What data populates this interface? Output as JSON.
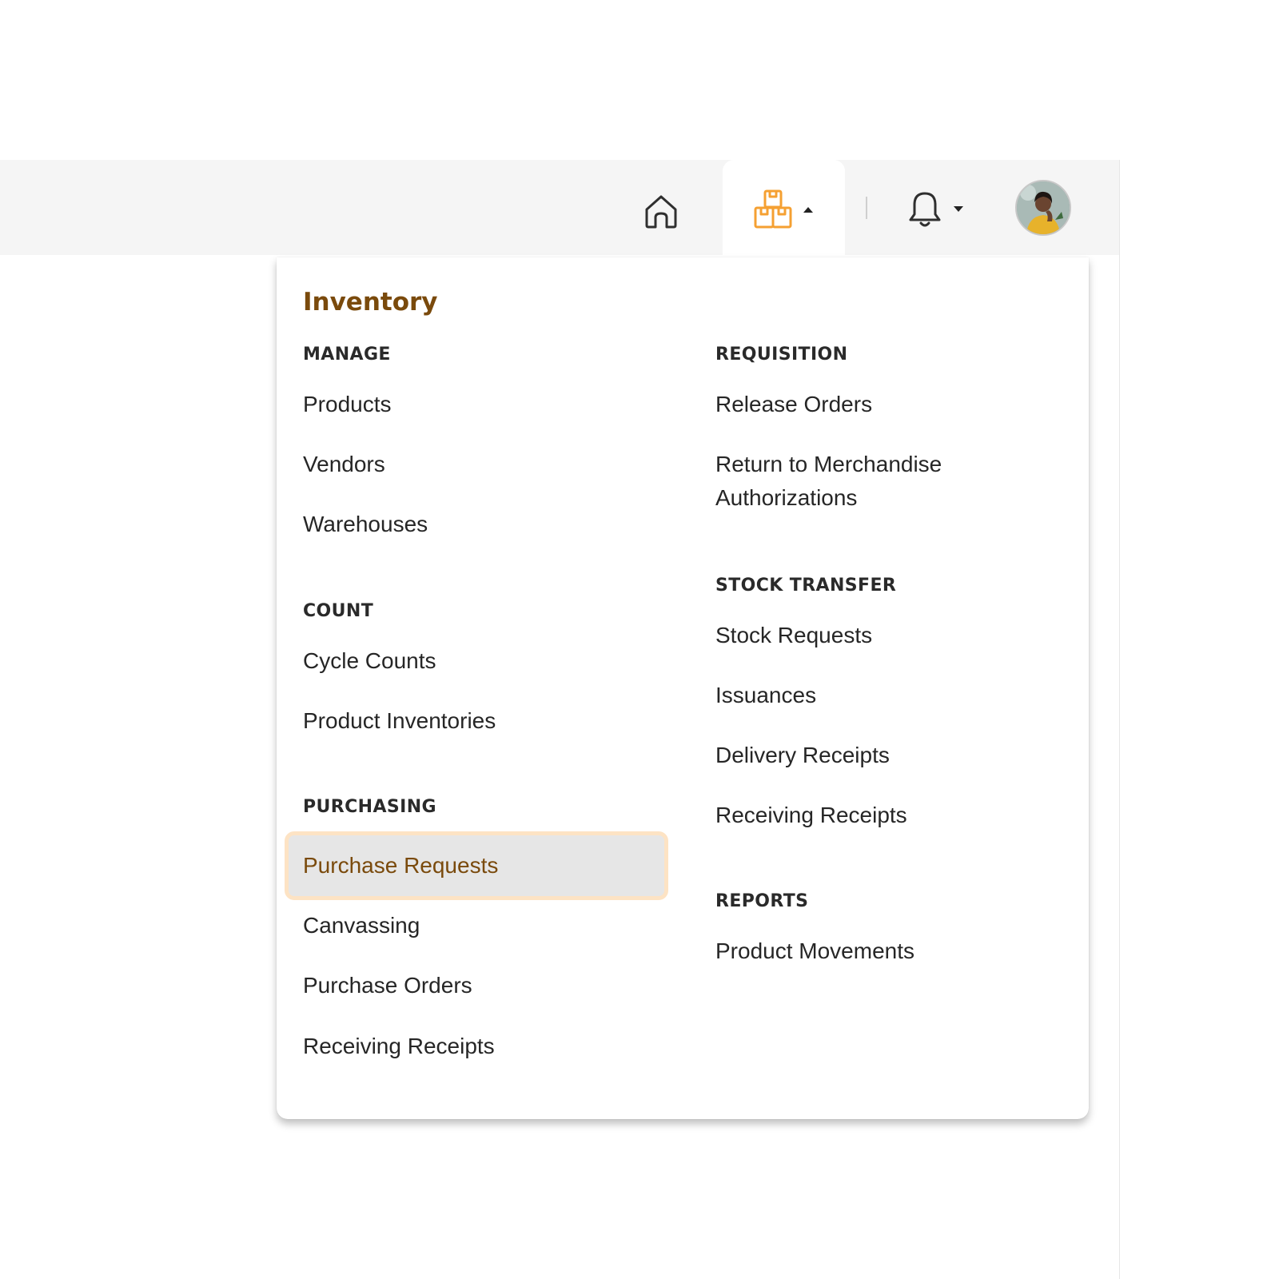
{
  "topbar": {
    "icons": {
      "home": "home-icon",
      "inventory": "boxes-icon",
      "notifications": "bell-icon",
      "avatar": "user-avatar"
    },
    "colors": {
      "bar_background": "#f5f5f5",
      "inventory_icon": "#f5a032",
      "icon_stroke": "#2f2f2f"
    }
  },
  "menu": {
    "title": "Inventory",
    "accent_color": "#7a4a0c",
    "active_item_background": "#e6e6e6",
    "active_item_border": "#fde3c4",
    "left_column": {
      "manage": {
        "heading": "MANAGE",
        "items": [
          "Products",
          "Vendors",
          "Warehouses"
        ]
      },
      "count": {
        "heading": "COUNT",
        "items": [
          "Cycle Counts",
          "Product Inventories"
        ]
      },
      "purchasing": {
        "heading": "PURCHASING",
        "items": [
          "Purchase Requests",
          "Canvassing",
          "Purchase Orders",
          "Receiving Receipts"
        ],
        "active_item": "Purchase Requests"
      }
    },
    "right_column": {
      "requisition": {
        "heading": "REQUISITION",
        "items": [
          "Release Orders",
          "Return to Merchandise Authorizations"
        ]
      },
      "stock_transfer": {
        "heading": "STOCK TRANSFER",
        "items": [
          "Stock Requests",
          "Issuances",
          "Delivery Receipts",
          "Receiving Receipts"
        ]
      },
      "reports": {
        "heading": "REPORTS",
        "items": [
          "Product Movements"
        ]
      }
    }
  }
}
